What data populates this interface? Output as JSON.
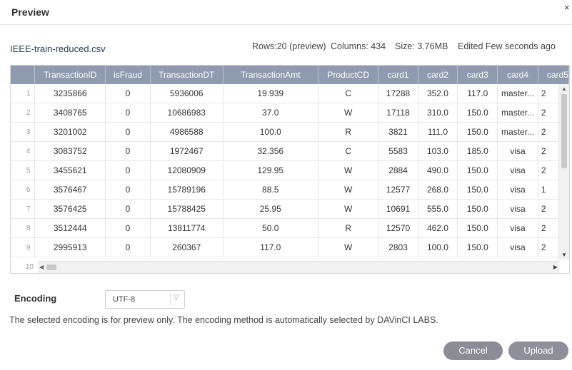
{
  "dialog": {
    "title": "Preview",
    "close_symbol": "×"
  },
  "file": {
    "name": "IEEE-train-reduced.csv",
    "rows": "Rows:20 (preview)",
    "columns": "Columns: 434",
    "size": "Size: 3.76MB",
    "edited": "Edited Few seconds ago"
  },
  "table": {
    "columns": [
      "TransactionID",
      "isFraud",
      "TransactionDT",
      "TransactionAmt",
      "ProductCD",
      "card1",
      "card2",
      "card3",
      "card4",
      "card5"
    ],
    "rows": [
      {
        "idx": "1",
        "cells": [
          "3235866",
          "0",
          "5936006",
          "19.939",
          "C",
          "17288",
          "352.0",
          "117.0",
          "master...",
          "2"
        ]
      },
      {
        "idx": "2",
        "cells": [
          "3408765",
          "0",
          "10686983",
          "37.0",
          "W",
          "17118",
          "310.0",
          "150.0",
          "master...",
          "2"
        ]
      },
      {
        "idx": "3",
        "cells": [
          "3201002",
          "0",
          "4986588",
          "100.0",
          "R",
          "3821",
          "111.0",
          "150.0",
          "master...",
          "2"
        ]
      },
      {
        "idx": "4",
        "cells": [
          "3083752",
          "0",
          "1972467",
          "32.356",
          "C",
          "5583",
          "103.0",
          "185.0",
          "visa",
          "2"
        ]
      },
      {
        "idx": "5",
        "cells": [
          "3455621",
          "0",
          "12080909",
          "129.95",
          "W",
          "2884",
          "490.0",
          "150.0",
          "visa",
          "2"
        ]
      },
      {
        "idx": "6",
        "cells": [
          "3576467",
          "0",
          "15789196",
          "88.5",
          "W",
          "12577",
          "268.0",
          "150.0",
          "visa",
          "1"
        ]
      },
      {
        "idx": "7",
        "cells": [
          "3576425",
          "0",
          "15788425",
          "25.95",
          "W",
          "10691",
          "555.0",
          "150.0",
          "visa",
          "2"
        ]
      },
      {
        "idx": "8",
        "cells": [
          "3512444",
          "0",
          "13811774",
          "50.0",
          "R",
          "12570",
          "462.0",
          "150.0",
          "visa",
          "2"
        ]
      },
      {
        "idx": "9",
        "cells": [
          "2995913",
          "0",
          "260367",
          "117.0",
          "W",
          "2803",
          "100.0",
          "150.0",
          "visa",
          "2"
        ]
      }
    ],
    "next_row_idx": "10"
  },
  "encoding": {
    "label": "Encoding",
    "value": "UTF-8",
    "note": "The selected encoding is for preview only. The encoding method is automatically selected by DAVinCI LABS."
  },
  "buttons": {
    "cancel": "Cancel",
    "upload": "Upload"
  },
  "colors": {
    "header_bg": "#8e9bb0",
    "button_bg": "#8c8c99"
  },
  "icons": [
    "close-icon",
    "chevron-down-icon",
    "scroll-up-icon",
    "scroll-down-icon",
    "scroll-left-icon",
    "scroll-right-icon"
  ]
}
